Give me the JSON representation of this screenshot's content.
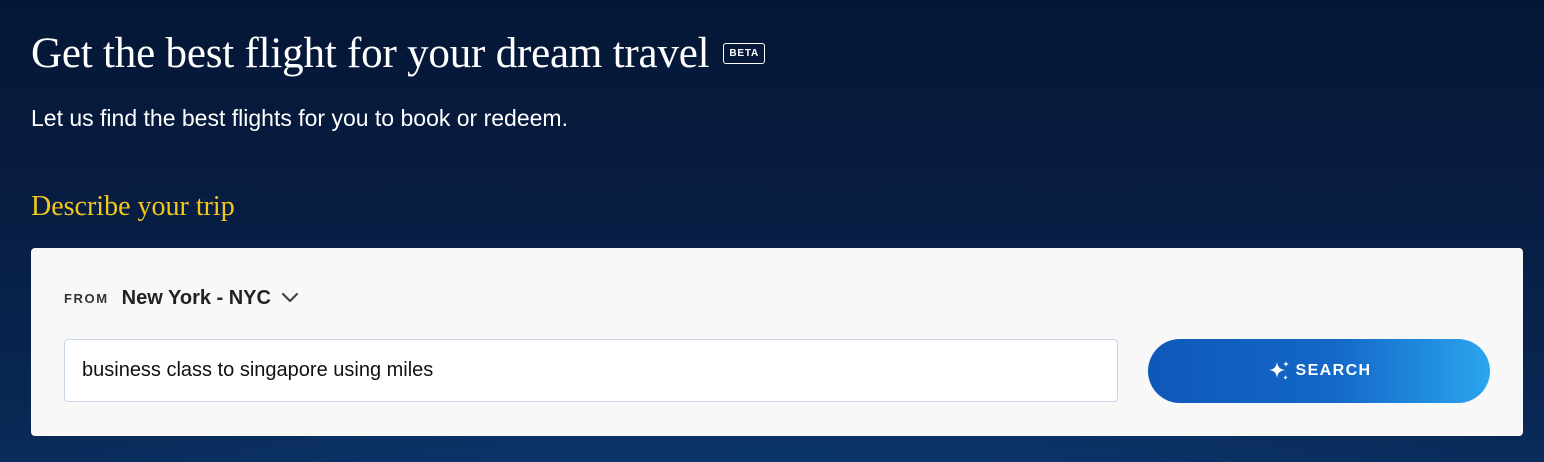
{
  "hero": {
    "title": "Get the best flight for your dream travel",
    "badge": "BETA",
    "subtitle": "Let us find the best flights for you to book or redeem."
  },
  "trip": {
    "heading": "Describe your trip",
    "from_label": "FROM",
    "from_value": "New York - NYC",
    "query_value": "business class to singapore using miles",
    "search_label": "SEARCH",
    "icons": {
      "dropdown": "chevron-down-icon",
      "search": "sparkle-icon"
    }
  },
  "colors": {
    "background": "#061736",
    "heading_accent": "#f2c71c",
    "card": "#f8f8f8",
    "button_start": "#0d58b8",
    "button_end": "#2aa5ee"
  }
}
